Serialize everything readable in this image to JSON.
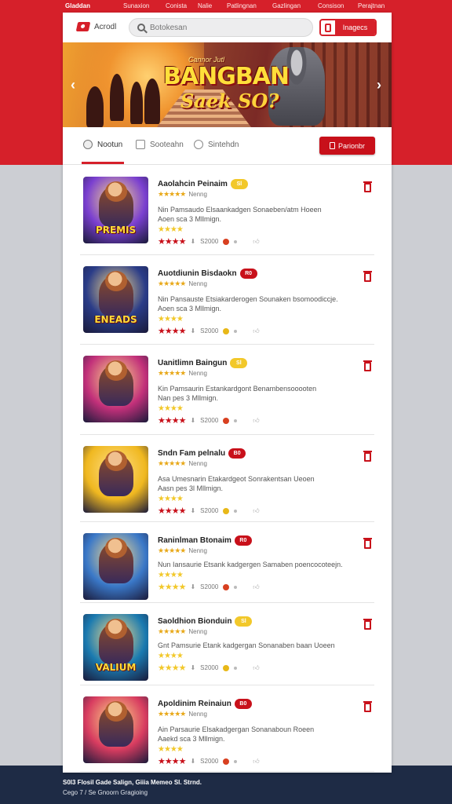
{
  "topnav": {
    "brand": "Gladdan",
    "links": [
      "Sunaxion",
      "Conista",
      "Nalie",
      "Patlingnan",
      "Gazlingan",
      "Consison",
      "Perajtnan"
    ]
  },
  "header": {
    "logo_text": "Acrodl",
    "search_placeholder": "Botokesan",
    "login_label": "Inagecs"
  },
  "banner": {
    "small": "Cannor Jutl",
    "title": "BANGBAN",
    "subtitle": "Saek SO?"
  },
  "tabs": [
    {
      "label": "Nootun"
    },
    {
      "label": "Sooteahn"
    },
    {
      "label": "Sintehdn"
    }
  ],
  "favorites_label": "Parionbr",
  "items": [
    {
      "title": "Aaolahcin Peinaim",
      "badge": "Sl",
      "badge_color": "yellow",
      "subtitle": "Nenng",
      "desc1": "Nin Pamsaudo Elsaankadgen Sonaeben/atm Hoeen",
      "desc2": "Aoen sca 3 Mllmign.",
      "count": "S2000",
      "thumb_label": "PREMIS",
      "thumb_bg": "#7a3fd0"
    },
    {
      "title": "Auotdiunin Bisdaokn",
      "badge": "R0",
      "badge_color": "red",
      "subtitle": "Nenng",
      "desc1": "Nin Pansauste Etsiakarderogen Sounaken bsomoodiccje.",
      "desc2": "Aoen sca 3 Mllmign.",
      "count": "S2000",
      "thumb_label": "ENEADS",
      "thumb_bg": "#2a3c88"
    },
    {
      "title": "Uanitlimn Baingun",
      "badge": "Sl",
      "badge_color": "yellow",
      "subtitle": "Nenng",
      "desc1": "Kin Pamsaurin Estankardgont Benambensooooten",
      "desc2": "Nan pes 3 Mllmign.",
      "count": "S2000",
      "thumb_label": "",
      "thumb_bg": "#c2307a"
    },
    {
      "title": "Sndn Fam pelnalu",
      "badge": "B0",
      "badge_color": "red",
      "subtitle": "Nenng",
      "desc1": "Asa Umesnarin Etakardgeot Sonrakentsan Ueoen",
      "desc2": "Aasn pes 3l Mllmign.",
      "count": "S2000",
      "thumb_label": "",
      "thumb_bg": "#f0b820"
    },
    {
      "title": "Raninlman Btonaim",
      "badge": "R0",
      "badge_color": "red",
      "subtitle": "Nenng",
      "desc1": "Nun Iansaurie Etsank kadgergen Samaben poencocoteejn.",
      "desc2": "",
      "count": "S2000",
      "thumb_label": "",
      "thumb_bg": "#3a78c8"
    },
    {
      "title": "Saoldhion Bionduin",
      "badge": "Sl",
      "badge_color": "yellow",
      "subtitle": "Nenng",
      "desc1": "Gnt Pamsurie Etank kadgergan Sonanaben baan Uoeen",
      "desc2": "",
      "count": "S2000",
      "thumb_label": "VALIUM",
      "thumb_bg": "#1a7ab0"
    },
    {
      "title": "Apoldinim Reinaiun",
      "badge": "B0",
      "badge_color": "red",
      "subtitle": "Nenng",
      "desc1": "Ain Parsaurie Elsakadgergan Sonanaboun Roeen",
      "desc2": "Aaekd sca 3 Mllmign.",
      "count": "S2000",
      "thumb_label": "",
      "thumb_bg": "#d83c60"
    }
  ],
  "footer": {
    "line1": "S0l3 Flosil Gade Salign, Giiia Memeo Sl. Strnd.",
    "line2": "Cego 7 / Se Gnoorn Gragioing"
  }
}
